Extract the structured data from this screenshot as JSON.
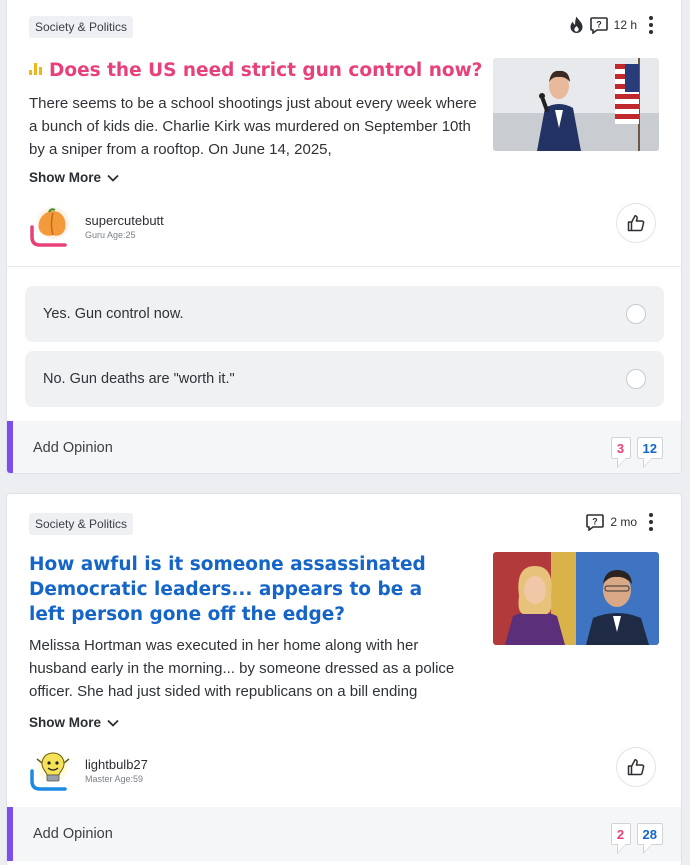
{
  "posts": [
    {
      "category": "Society & Politics",
      "time": "12 h",
      "title": "Does the US need strict gun control now?",
      "body": "There seems to be a school shootings just about every week where a bunch of kids die. Charlie Kirk was murdered on September 10th by a sniper from a rooftop. On June 14, 2025,",
      "show_more": "Show More",
      "user": {
        "name": "supercutebutt",
        "rank": "Guru Age:25"
      },
      "options": [
        "Yes. Gun control now.",
        "No. Gun deaths are \"worth it.\""
      ],
      "add_opinion": "Add Opinion",
      "counts": {
        "likes": "3",
        "opinions": "12"
      }
    },
    {
      "category": "Society & Politics",
      "time": "2 mo",
      "title": "How awful is it someone assassinated Democratic leaders... appears to be a left person gone off the edge?",
      "body": "Melissa Hortman was executed in her home along with her husband early in the morning... by someone dressed as a police officer. She had just sided with republicans on a bill ending",
      "show_more": "Show More",
      "user": {
        "name": "lightbulb27",
        "rank": "Master Age:59"
      },
      "add_opinion": "Add Opinion",
      "counts": {
        "likes": "2",
        "opinions": "28"
      }
    }
  ],
  "colors": {
    "poll_title": "#e8407a",
    "question_title": "#1565c8",
    "accent_bar": "#7b4ef0"
  }
}
